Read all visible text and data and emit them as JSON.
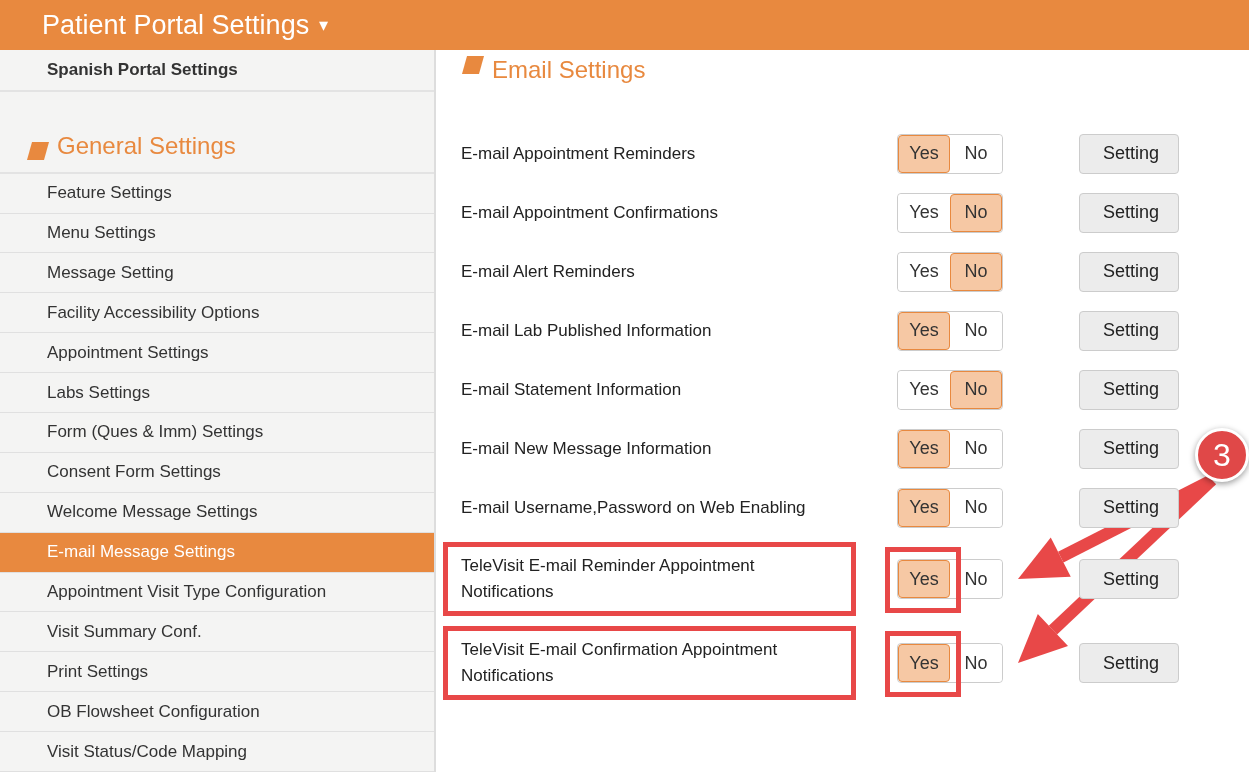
{
  "header": {
    "title": "Patient Portal Settings",
    "caret": "▾"
  },
  "sidebar": {
    "top_item": "Spanish Portal Settings",
    "section_title": "General Settings",
    "items": [
      {
        "label": "Feature Settings",
        "selected": false
      },
      {
        "label": "Menu Settings",
        "selected": false
      },
      {
        "label": "Message Setting",
        "selected": false
      },
      {
        "label": "Facility Accessibility Options",
        "selected": false
      },
      {
        "label": "Appointment Settings",
        "selected": false
      },
      {
        "label": "Labs Settings",
        "selected": false
      },
      {
        "label": "Form (Ques & Imm) Settings",
        "selected": false
      },
      {
        "label": "Consent Form Settings",
        "selected": false
      },
      {
        "label": "Welcome Message Settings",
        "selected": false
      },
      {
        "label": "E-mail Message Settings",
        "selected": true
      },
      {
        "label": "Appointment Visit Type Configuration",
        "selected": false
      },
      {
        "label": "Visit Summary Conf.",
        "selected": false
      },
      {
        "label": "Print Settings",
        "selected": false
      },
      {
        "label": "OB Flowsheet Configuration",
        "selected": false
      },
      {
        "label": "Visit Status/Code Mapping",
        "selected": false
      }
    ]
  },
  "main": {
    "heading": "Email Settings",
    "rows": [
      {
        "label": "E-mail Appointment Reminders",
        "yes": "Yes",
        "no": "No",
        "enabled": true,
        "button": "Setting",
        "highlighted": false
      },
      {
        "label": "E-mail Appointment Confirmations",
        "yes": "Yes",
        "no": "No",
        "enabled": false,
        "button": "Setting",
        "highlighted": false
      },
      {
        "label": "E-mail Alert Reminders",
        "yes": "Yes",
        "no": "No",
        "enabled": false,
        "button": "Setting",
        "highlighted": false
      },
      {
        "label": "E-mail Lab Published Information",
        "yes": "Yes",
        "no": "No",
        "enabled": true,
        "button": "Setting",
        "highlighted": false
      },
      {
        "label": "E-mail Statement Information",
        "yes": "Yes",
        "no": "No",
        "enabled": false,
        "button": "Setting",
        "highlighted": false
      },
      {
        "label": "E-mail New Message Information",
        "yes": "Yes",
        "no": "No",
        "enabled": true,
        "button": "Setting",
        "highlighted": false
      },
      {
        "label": "E-mail Username,Password on Web Enabling",
        "yes": "Yes",
        "no": "No",
        "enabled": true,
        "button": "Setting",
        "highlighted": false
      },
      {
        "label": "TeleVisit E-mail Reminder Appointment Notifications",
        "yes": "Yes",
        "no": "No",
        "enabled": true,
        "button": "Setting",
        "highlighted": true
      },
      {
        "label": "TeleVisit E-mail Confirmation Appointment Notifications",
        "yes": "Yes",
        "no": "No",
        "enabled": true,
        "button": "Setting",
        "highlighted": true
      }
    ]
  },
  "annotation": {
    "badge": "3"
  }
}
